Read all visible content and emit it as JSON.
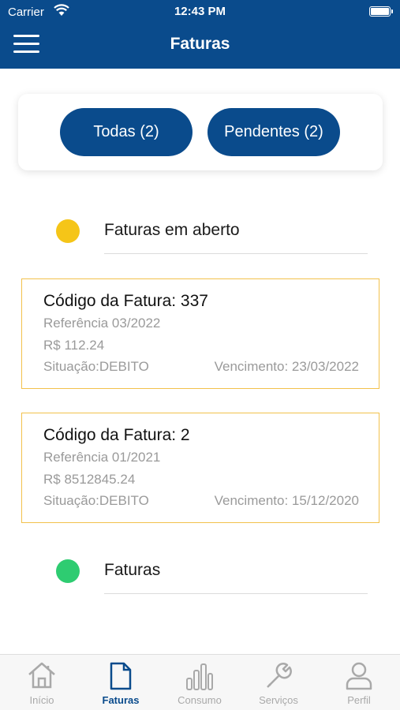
{
  "status_bar": {
    "carrier": "Carrier",
    "time": "12:43 PM"
  },
  "header": {
    "title": "Faturas"
  },
  "filters": [
    {
      "label": "Todas (2)"
    },
    {
      "label": "Pendentes (2)"
    }
  ],
  "sections": [
    {
      "label": "Faturas em aberto",
      "color": "#f5c518"
    },
    {
      "label": "Faturas",
      "color": "#2ecc71"
    }
  ],
  "invoices": [
    {
      "code": "Código da Fatura: 337",
      "reference": "Referência 03/2022",
      "amount": "R$ 112.24",
      "status": "Situação:DEBITO",
      "due": "Vencimento: 23/03/2022"
    },
    {
      "code": "Código da Fatura: 2",
      "reference": "Referência 01/2021",
      "amount": "R$ 8512845.24",
      "status": "Situação:DEBITO",
      "due": "Vencimento: 15/12/2020"
    }
  ],
  "tabbar": {
    "active": "Faturas",
    "items": [
      {
        "label": "Início",
        "icon": "home-icon"
      },
      {
        "label": "Faturas",
        "icon": "document-icon"
      },
      {
        "label": "Consumo",
        "icon": "bar-chart-icon"
      },
      {
        "label": "Serviços",
        "icon": "wrench-icon"
      },
      {
        "label": "Perfil",
        "icon": "user-icon"
      }
    ]
  },
  "colors": {
    "primary": "#0a4b8c",
    "card_border": "#f2c14c",
    "muted_text": "#9a9a9a"
  }
}
